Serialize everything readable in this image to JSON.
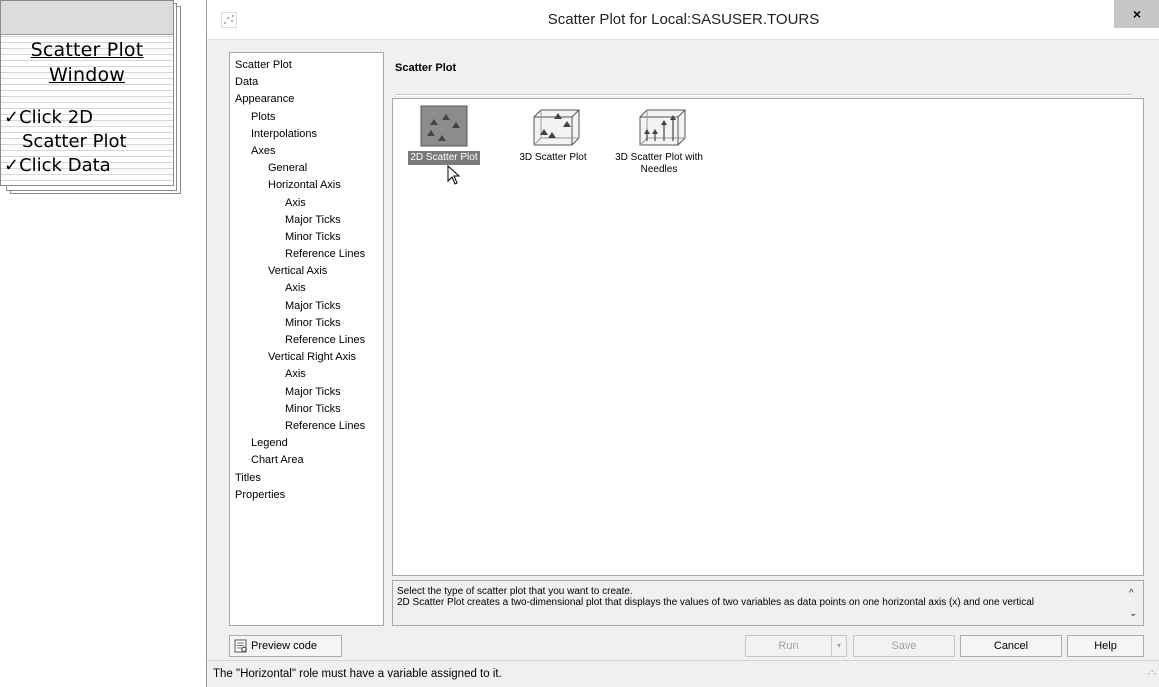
{
  "note": {
    "title_line1": "Scatter Plot",
    "title_line2": "Window",
    "check_mark": "✓",
    "steps": [
      "Click 2D",
      "Scatter Plot",
      "Click Data"
    ]
  },
  "dialog": {
    "title": "Scatter Plot for Local:SASUSER.TOURS",
    "close_label": "×"
  },
  "nav": [
    {
      "label": "Scatter Plot",
      "level": 0
    },
    {
      "label": "Data",
      "level": 0
    },
    {
      "label": "Appearance",
      "level": 0
    },
    {
      "label": "Plots",
      "level": 1
    },
    {
      "label": "Interpolations",
      "level": 1
    },
    {
      "label": "Axes",
      "level": 1
    },
    {
      "label": "General",
      "level": 2
    },
    {
      "label": "Horizontal Axis",
      "level": 2
    },
    {
      "label": "Axis",
      "level": 3
    },
    {
      "label": "Major Ticks",
      "level": 3
    },
    {
      "label": "Minor Ticks",
      "level": 3
    },
    {
      "label": "Reference Lines",
      "level": 3
    },
    {
      "label": "Vertical Axis",
      "level": 2
    },
    {
      "label": "Axis",
      "level": 3
    },
    {
      "label": "Major Ticks",
      "level": 3
    },
    {
      "label": "Minor Ticks",
      "level": 3
    },
    {
      "label": "Reference Lines",
      "level": 3
    },
    {
      "label": "Vertical Right Axis",
      "level": 2
    },
    {
      "label": "Axis",
      "level": 3
    },
    {
      "label": "Major Ticks",
      "level": 3
    },
    {
      "label": "Minor Ticks",
      "level": 3
    },
    {
      "label": "Reference Lines",
      "level": 3
    },
    {
      "label": "Legend",
      "level": 1
    },
    {
      "label": "Chart Area",
      "level": 1
    },
    {
      "label": "Titles",
      "level": 0
    },
    {
      "label": "Properties",
      "level": 0
    }
  ],
  "main": {
    "section_title": "Scatter Plot",
    "plot_types": [
      {
        "label": "2D Scatter Plot",
        "selected": true,
        "icon": "scatter-2d-icon"
      },
      {
        "label": "3D Scatter Plot",
        "selected": false,
        "icon": "scatter-3d-icon"
      },
      {
        "label": "3D Scatter Plot with Needles",
        "selected": false,
        "icon": "scatter-3d-needles-icon"
      }
    ],
    "description_line1": "Select the type of scatter plot that you want to create.",
    "description_line2": "2D Scatter Plot creates a two-dimensional plot that displays the values of two variables as data points on one horizontal axis (x) and one vertical"
  },
  "buttons": {
    "preview": "Preview code",
    "run": "Run",
    "run_dropdown": "▾",
    "save": "Save",
    "cancel": "Cancel",
    "help": "Help"
  },
  "status": {
    "message": "The \"Horizontal\" role must have a variable assigned to it."
  },
  "colors": {
    "selection": "#7a7a7a",
    "dialog_bg": "#f0f0f0",
    "close_bg": "#c7c7c7"
  }
}
